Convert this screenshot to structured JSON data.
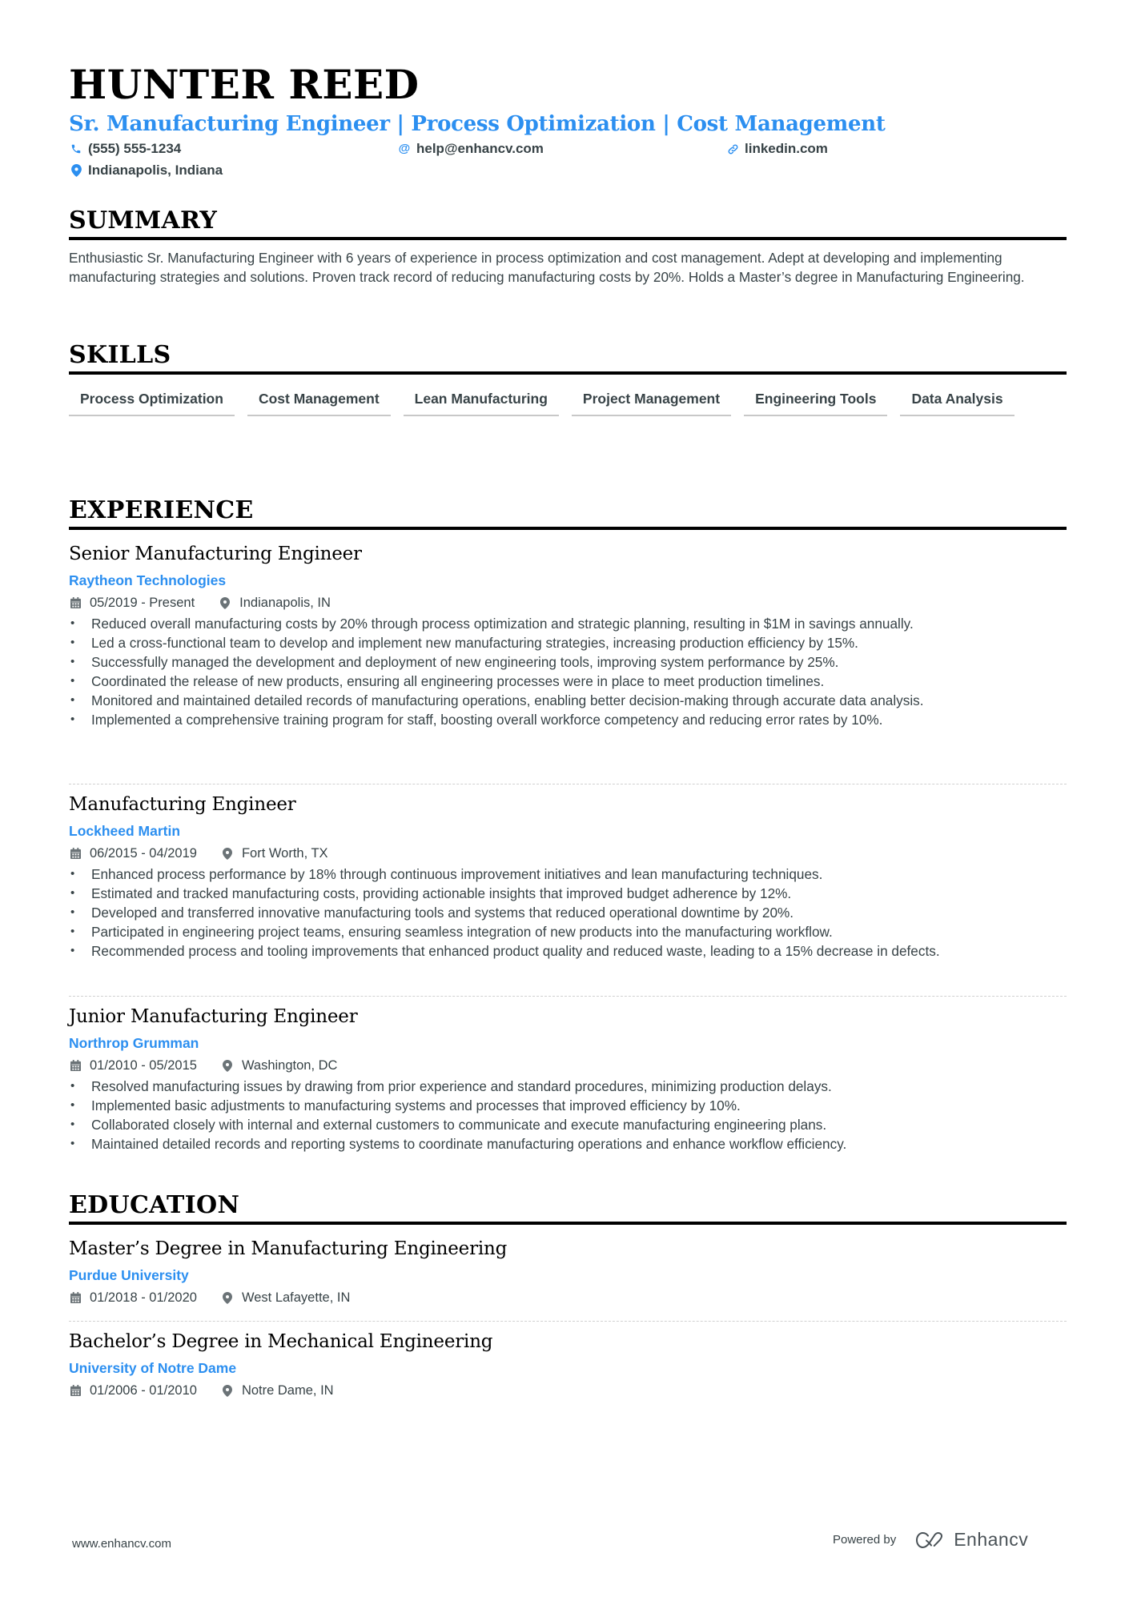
{
  "header": {
    "name": "HUNTER REED",
    "headline": "Sr. Manufacturing Engineer | Process Optimization | Cost Management",
    "phone": "(555) 555-1234",
    "email": "help@enhancv.com",
    "linkedin": "linkedin.com",
    "location": "Indianapolis, Indiana",
    "icons": {
      "phone": "phone-icon",
      "email": "at-icon",
      "linkedin": "link-icon",
      "location": "map-pin-icon"
    },
    "accent_color": "#2c8ff0"
  },
  "summary": {
    "title": "SUMMARY",
    "text": "Enthusiastic Sr. Manufacturing Engineer with 6 years of experience in process optimization and cost management. Adept at developing and implementing manufacturing strategies and solutions. Proven track record of reducing manufacturing costs by 20%. Holds a Master’s degree in Manufacturing Engineering."
  },
  "skills": {
    "title": "SKILLS",
    "items": [
      "Process Optimization",
      "Cost Management",
      "Lean Manufacturing",
      "Project Management",
      "Engineering Tools",
      "Data Analysis"
    ]
  },
  "experience": {
    "title": "EXPERIENCE",
    "items": [
      {
        "role": "Senior Manufacturing Engineer",
        "company": "Raytheon Technologies",
        "dates": "05/2019 - Present",
        "location": "Indianapolis, IN",
        "bullets": [
          "Reduced overall manufacturing costs by 20% through process optimization and strategic planning, resulting in $1M in savings annually.",
          "Led a cross-functional team to develop and implement new manufacturing strategies, increasing production efficiency by 15%.",
          "Successfully managed the development and deployment of new engineering tools, improving system performance by 25%.",
          "Coordinated the release of new products, ensuring all engineering processes were in place to meet production timelines.",
          "Monitored and maintained detailed records of manufacturing operations, enabling better decision-making through accurate data analysis.",
          "Implemented a comprehensive training program for staff, boosting overall workforce competency and reducing error rates by 10%."
        ]
      },
      {
        "role": "Manufacturing Engineer",
        "company": "Lockheed Martin",
        "dates": "06/2015 - 04/2019",
        "location": "Fort Worth, TX",
        "bullets": [
          "Enhanced process performance by 18% through continuous improvement initiatives and lean manufacturing techniques.",
          "Estimated and tracked manufacturing costs, providing actionable insights that improved budget adherence by 12%.",
          "Developed and transferred innovative manufacturing tools and systems that reduced operational downtime by 20%.",
          "Participated in engineering project teams, ensuring seamless integration of new products into the manufacturing workflow.",
          "Recommended process and tooling improvements that enhanced product quality and reduced waste, leading to a 15% decrease in defects."
        ]
      },
      {
        "role": "Junior Manufacturing Engineer",
        "company": "Northrop Grumman",
        "dates": "01/2010 - 05/2015",
        "location": "Washington, DC",
        "bullets": [
          "Resolved manufacturing issues by drawing from prior experience and standard procedures, minimizing production delays.",
          "Implemented basic adjustments to manufacturing systems and processes that improved efficiency by 10%.",
          "Collaborated closely with internal and external customers to communicate and execute manufacturing engineering plans.",
          "Maintained detailed records and reporting systems to coordinate manufacturing operations and enhance workflow efficiency."
        ]
      }
    ]
  },
  "education": {
    "title": "EDUCATION",
    "items": [
      {
        "degree": "Master’s Degree in Manufacturing Engineering",
        "school": "Purdue University",
        "dates": "01/2018 - 01/2020",
        "location": "West Lafayette, IN"
      },
      {
        "degree": "Bachelor’s Degree in Mechanical Engineering",
        "school": "University of Notre Dame",
        "dates": "01/2006 - 01/2010",
        "location": "Notre Dame, IN"
      }
    ]
  },
  "footer": {
    "website": "www.enhancv.com",
    "powered_by": "Powered by",
    "brand": "Enhancv"
  }
}
